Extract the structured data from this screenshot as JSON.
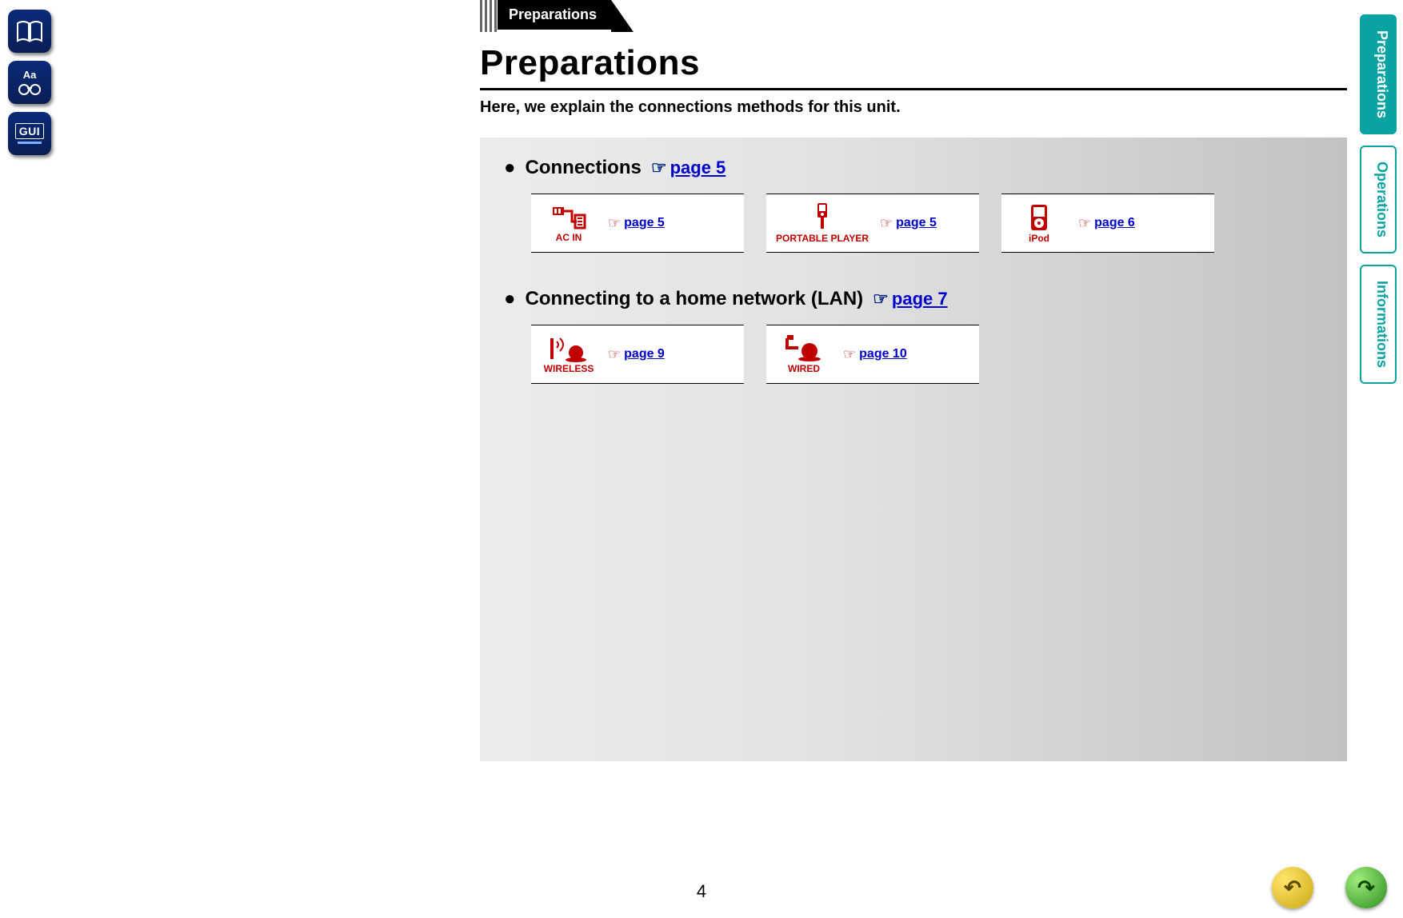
{
  "breadcrumb": {
    "label": "Preparations"
  },
  "title": "Preparations",
  "intro": "Here, we explain the connections methods for this unit.",
  "sections": {
    "connections": {
      "heading": "Connections",
      "pageLink": "page 5",
      "cards": [
        {
          "iconCaption": "AC IN",
          "link": "page 5"
        },
        {
          "iconCaption": "PORTABLE PLAYER",
          "link": "page 5"
        },
        {
          "iconCaption": "iPod",
          "link": "page 6"
        }
      ]
    },
    "lan": {
      "heading": "Connecting to a home network (LAN)",
      "pageLink": "page 7",
      "cards": [
        {
          "iconCaption": "WIRELESS",
          "link": "page 9"
        },
        {
          "iconCaption": "WIRED",
          "link": "page 10"
        }
      ]
    }
  },
  "rightTabs": {
    "preparations": "Preparations",
    "operations": "Operations",
    "informations": "Informations"
  },
  "leftRail": {
    "aa": "Aa",
    "gui": "GUI"
  },
  "pageNumber": "4"
}
